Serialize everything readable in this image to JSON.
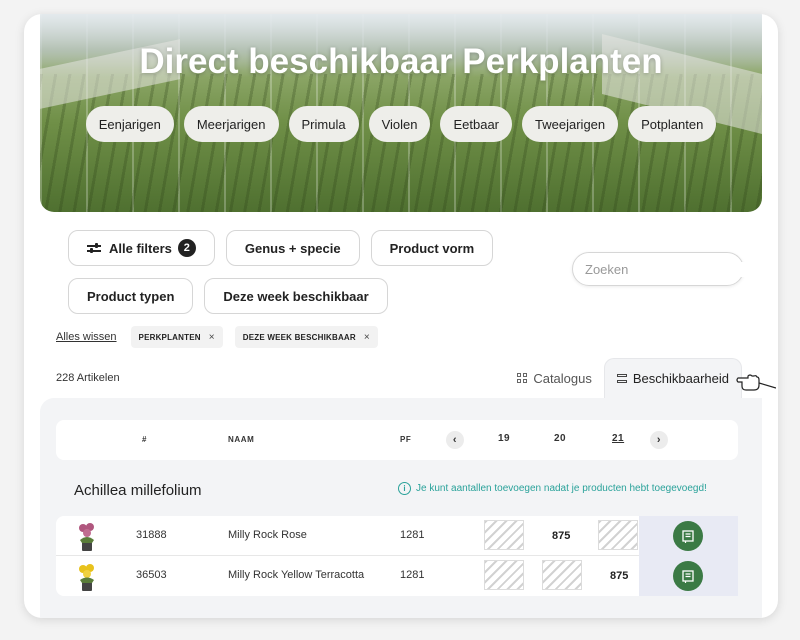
{
  "hero": {
    "title": "Direct beschikbaar Perkplanten",
    "categories": [
      "Eenjarigen",
      "Meerjarigen",
      "Primula",
      "Violen",
      "Eetbaar",
      "Tweejarigen",
      "Potplanten"
    ]
  },
  "filters": {
    "all_filters_label": "Alle filters",
    "all_filters_count": "2",
    "buttons": [
      "Genus + specie",
      "Product vorm",
      "Product typen",
      "Deze week beschikbaar"
    ]
  },
  "search": {
    "placeholder": "Zoeken",
    "value": ""
  },
  "active_filters": {
    "clear_label": "Alles wissen",
    "tags": [
      "PERKPLANTEN",
      "DEZE WEEK BESCHIKBAAR"
    ],
    "remove_symbol": "×"
  },
  "results": {
    "count_label": "228 Artikelen"
  },
  "view_tabs": {
    "catalog": "Catalogus",
    "availability": "Beschikbaarheid",
    "active": "availability"
  },
  "table": {
    "headers": {
      "number": "#",
      "name": "NAAM",
      "pf": "PF"
    },
    "weeks": [
      "19",
      "20",
      "21"
    ],
    "current_week": "21",
    "prev_symbol": "‹",
    "next_symbol": "›"
  },
  "group": {
    "title": "Achillea millefolium",
    "info": "Je kunt aantallen toevoegen nadat je producten hebt toegevoegd!",
    "info_icon": "i"
  },
  "rows": [
    {
      "number": "31888",
      "name": "Milly Rock Rose",
      "pf": "1281",
      "weeks": [
        null,
        "875",
        null
      ],
      "flower_color": "#b0567e"
    },
    {
      "number": "36503",
      "name": "Milly Rock Yellow Terracotta",
      "pf": "1281",
      "weeks": [
        null,
        null,
        "875"
      ],
      "flower_color": "#e8c21c"
    }
  ],
  "colors": {
    "accent_green": "#3b7a45",
    "info_teal": "#2aa29a"
  }
}
